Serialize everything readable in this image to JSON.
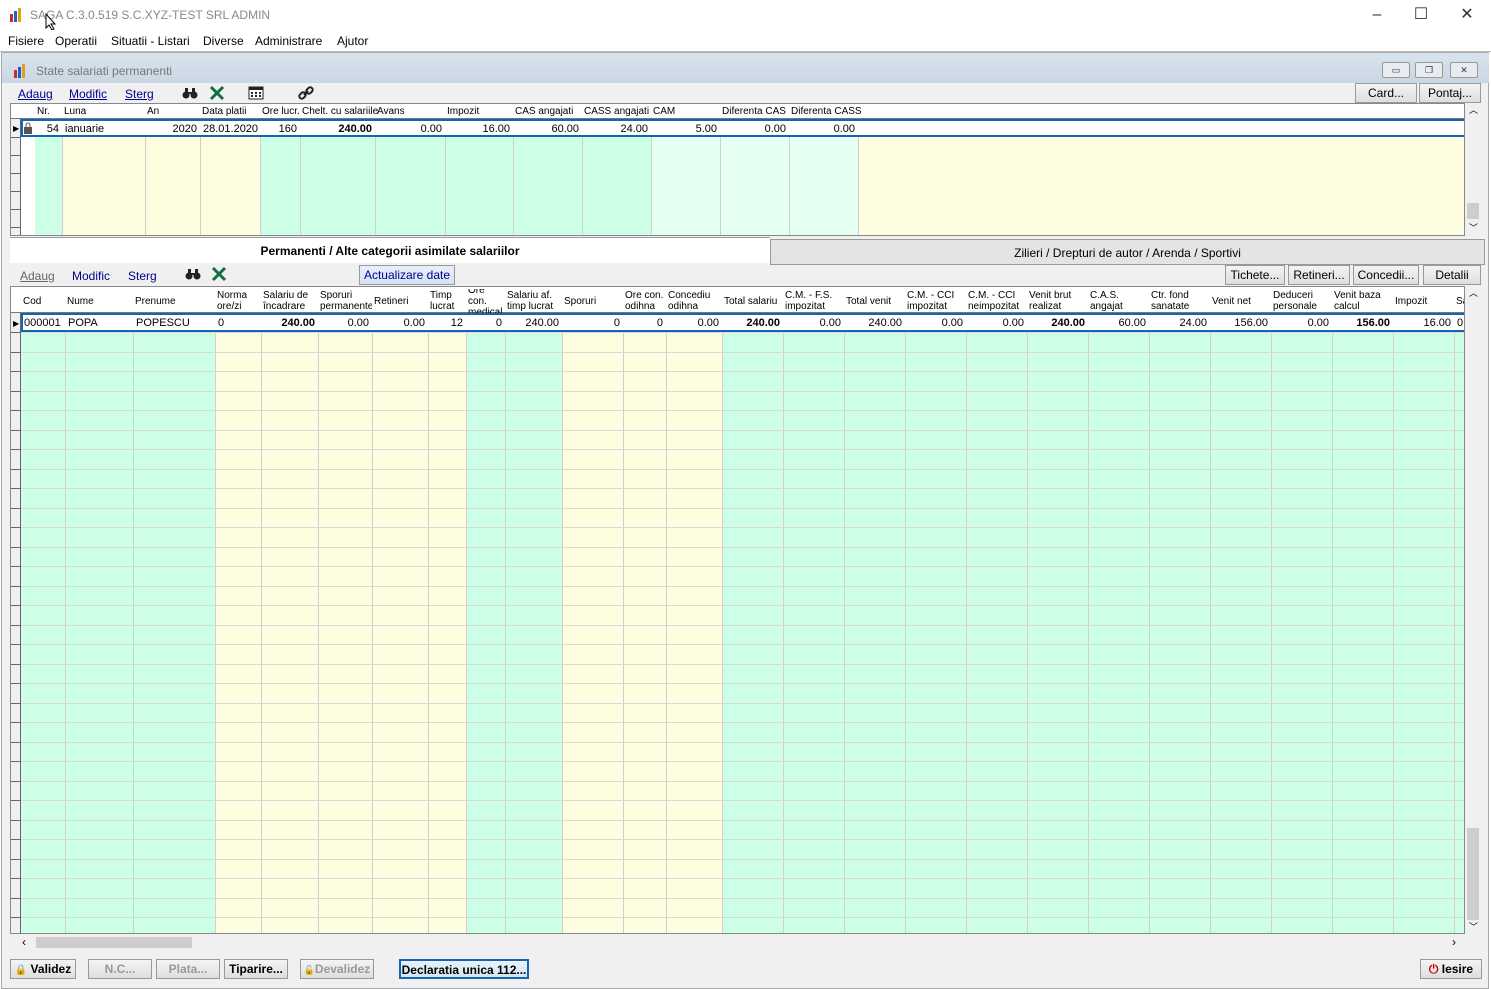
{
  "window": {
    "title": "SAGA C.3.0.519  S.C.XYZ-TEST SRL  ADMIN"
  },
  "menu": [
    "Fisiere",
    "Operatii",
    "Situatii - Listari",
    "Diverse",
    "Administrare",
    "Ajutor"
  ],
  "child_window": {
    "title": "State salariati permanenti"
  },
  "top_toolbar": {
    "add": "Adaug",
    "modify": "Modific",
    "delete": "Sterg",
    "card": "Card...",
    "pontaj": "Pontaj..."
  },
  "top_grid": {
    "headers": [
      "Nr.",
      "Luna",
      "An",
      "Data platii",
      "Ore lucr.",
      "Chelt. cu salariile",
      "Avans",
      "Impozit",
      "CAS angajati",
      "CASS angajati",
      "CAM",
      "Diferenta CAS",
      "Diferenta CASS"
    ],
    "row": [
      "54",
      "ianuarie",
      "2020",
      "28.01.2020",
      "160",
      "240.00",
      "0.00",
      "16.00",
      "60.00",
      "24.00",
      "5.00",
      "0.00",
      "0.00"
    ]
  },
  "tabs": {
    "active": "Permanenti / Alte categorii asimilate salariilor",
    "inactive": "Zilieri / Drepturi de autor / Arenda / Sportivi"
  },
  "bottom_toolbar": {
    "add": "Adaug",
    "modify": "Modific",
    "delete": "Sterg",
    "update": "Actualizare date",
    "tichete": "Tichete...",
    "retineri": "Retineri...",
    "concedii": "Concedii...",
    "detalii": "Detalii"
  },
  "bottom_grid": {
    "headers": [
      "Cod",
      "Nume",
      "Prenume",
      "Norma ore/zi",
      "Salariu de încadrare",
      "Sporuri permanente",
      "Retineri",
      "Timp lucrat",
      "Ore con. medical",
      "Salariu af. timp lucrat",
      "Sporuri",
      "Ore con. odihna",
      "Concediu odihna",
      "Total salariu",
      "C.M. -  F.S. impozitat",
      "Total venit",
      "C.M. - CCI impozitat",
      "C.M. - CCI neimpozitat",
      "Venit brut realizat",
      "C.A.S. angajat",
      "Ctr. fond sanatate",
      "Venit net",
      "Deduceri personale",
      "Venit baza calcul",
      "Impozit",
      "Sa"
    ],
    "row": [
      "000001",
      "POPA",
      "POPESCU",
      "0",
      "240.00",
      "0.00",
      "0.00",
      "12",
      "0",
      "240.00",
      "0",
      "0",
      "0.00",
      "240.00",
      "0.00",
      "240.00",
      "0.00",
      "0.00",
      "240.00",
      "60.00",
      "24.00",
      "156.00",
      "0.00",
      "156.00",
      "16.00",
      "0"
    ]
  },
  "footer": {
    "validez": "Validez",
    "nc": "N.C...",
    "plata": "Plata...",
    "tiparire": "Tiparire...",
    "devalidez": "Devalidez",
    "declaratia": "Declaratia unica 112...",
    "iesire": "Iesire"
  },
  "colors": {
    "cream": "#fffde0",
    "mint": "#ccffe6",
    "selection": "#1464b4"
  }
}
